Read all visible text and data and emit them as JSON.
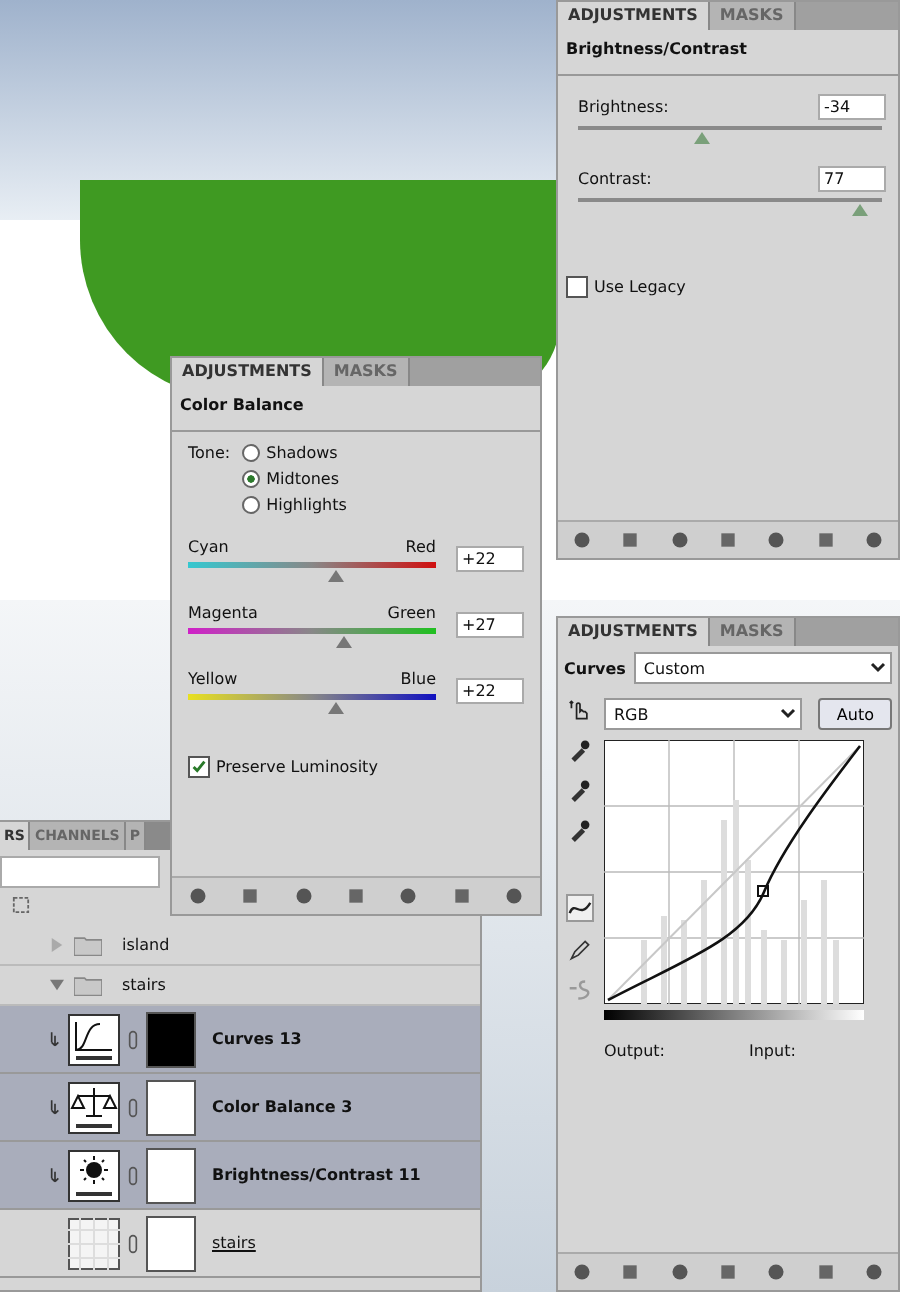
{
  "brightness_panel": {
    "tabs": [
      {
        "label": "ADJUSTMENTS",
        "selected": true
      },
      {
        "label": "MASKS",
        "selected": false
      }
    ],
    "title": "Brightness/Contrast",
    "sliders": [
      {
        "label": "Brightness:",
        "value": "-34",
        "level": 0.41
      },
      {
        "label": "Contrast:",
        "value": "77",
        "level": 0.93
      }
    ],
    "use_legacy": {
      "label": "Use Legacy",
      "checked": false
    }
  },
  "curves_panel": {
    "tabs": [
      {
        "label": "ADJUSTMENTS",
        "selected": true
      },
      {
        "label": "MASKS",
        "selected": false
      }
    ],
    "title": "Curves",
    "preset": "Custom",
    "channel": "RGB",
    "auto_button": "Auto",
    "output_label": "Output:",
    "input_label": "Input:"
  },
  "layers_panel": {
    "tabs": [
      {
        "label": "RS",
        "selected": true
      },
      {
        "label": "CHANNELS",
        "selected": false
      },
      {
        "label": "P",
        "selected": false
      }
    ],
    "layers": [
      {
        "name": "island",
        "kind": "group",
        "expanded": false,
        "selected": false
      },
      {
        "name": "stairs",
        "kind": "group",
        "expanded": true,
        "selected": false,
        "children": [
          {
            "name": "Curves 13",
            "kind": "curves",
            "selected": true,
            "mask_filled": true
          },
          {
            "name": "Color Balance 3",
            "kind": "color_balance",
            "selected": true,
            "mask_filled": false
          },
          {
            "name": "Brightness/Contrast 11",
            "kind": "brightness_contrast",
            "selected": true,
            "mask_filled": false
          },
          {
            "name": "stairs",
            "kind": "pixel",
            "selected": false,
            "mask_filled": false
          }
        ]
      }
    ]
  },
  "color_balance_panel": {
    "tabs": [
      {
        "label": "ADJUSTMENTS",
        "selected": true
      },
      {
        "label": "MASKS",
        "selected": false
      }
    ],
    "title": "Color Balance",
    "tone_label": "Tone:",
    "tones": [
      {
        "label": "Shadows",
        "selected": false
      },
      {
        "label": "Midtones",
        "selected": true
      },
      {
        "label": "Highlights",
        "selected": false
      }
    ],
    "sliders": [
      {
        "left": "Cyan",
        "right": "Red",
        "value": "+22",
        "level": 0.6
      },
      {
        "left": "Magenta",
        "right": "Green",
        "value": "+27",
        "level": 0.63
      },
      {
        "left": "Yellow",
        "right": "Blue",
        "value": "+22",
        "level": 0.6
      }
    ],
    "preserve_luminosity": {
      "label": "Preserve Luminosity",
      "checked": true
    }
  }
}
